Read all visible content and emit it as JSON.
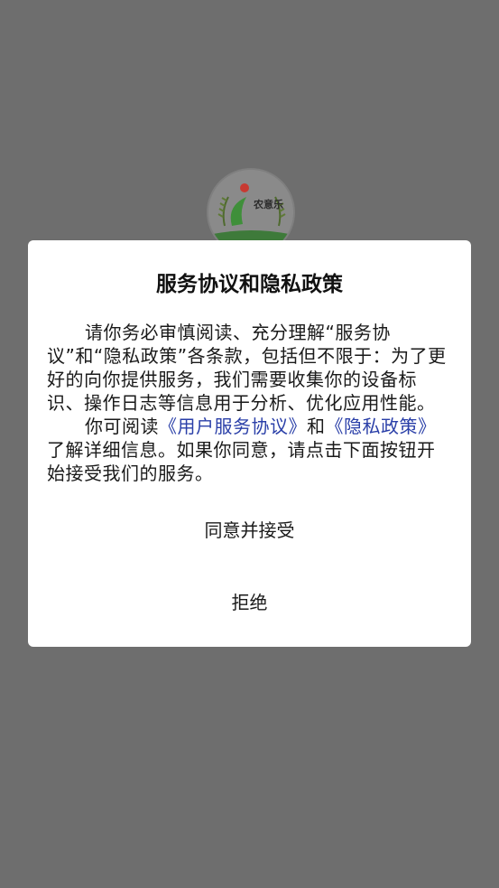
{
  "logo": {
    "text": "农意乐",
    "brand_color": "#2e8b3a",
    "accent_color": "#e53935"
  },
  "dialog": {
    "title": "服务协议和隐私政策",
    "paragraph1": "请你务必审慎阅读、充分理解“服务协议”和“隐私政策”各条款，包括但不限于：为了更好的向你提供服务，我们需要收集你的设备标识、操作日志等信息用于分析、优化应用性能。",
    "paragraph2_prefix": "你可阅读",
    "user_agreement_link": "《用户服务协议》",
    "paragraph2_and": "和",
    "privacy_policy_link": "《隐私政策》",
    "paragraph2_suffix": "了解详细信息。如果你同意，请点击下面按钮开始接受我们的服务。",
    "agree_button": "同意并接受",
    "refuse_button": "拒绝",
    "link_color": "#2a3fa8"
  }
}
